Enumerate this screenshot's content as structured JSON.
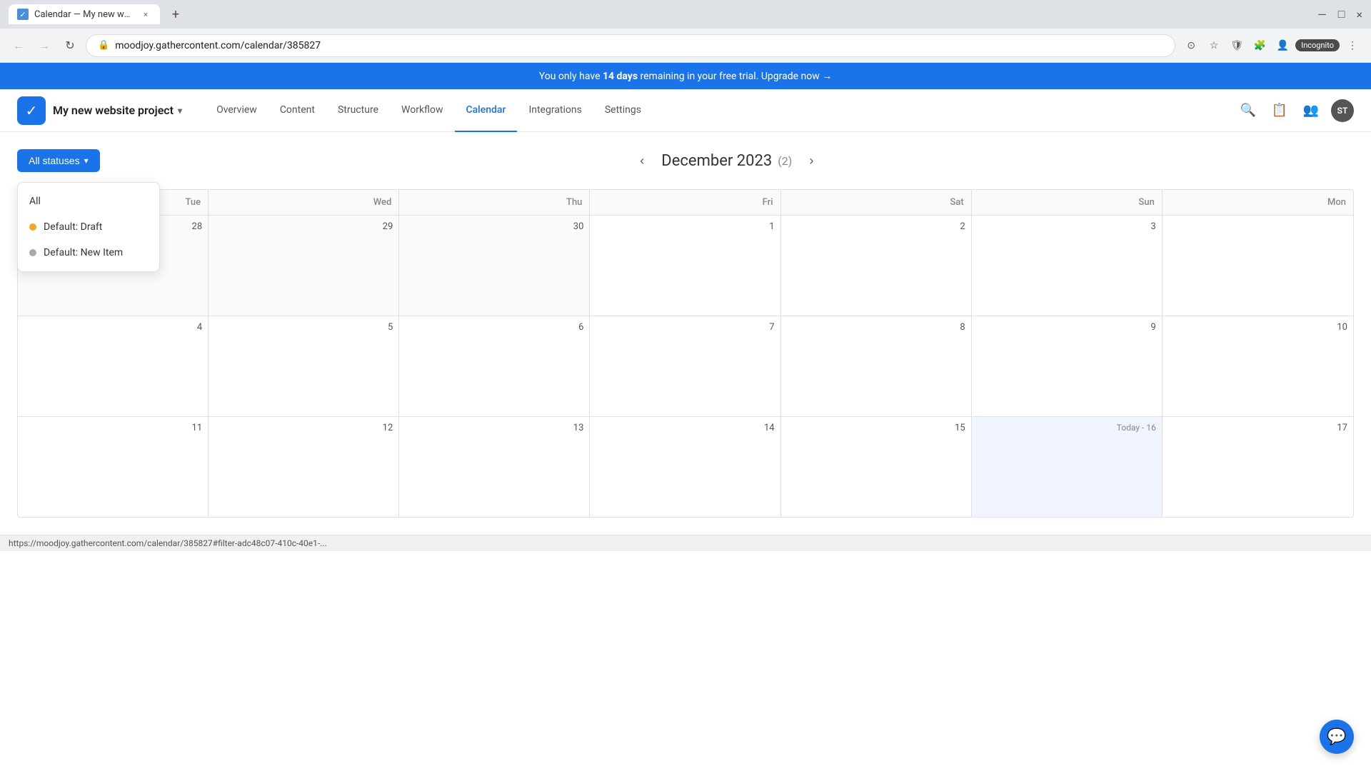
{
  "browser": {
    "tab_title": "Calendar — My new website p...",
    "tab_favicon": "✓",
    "tab_close": "×",
    "new_tab": "+",
    "nav_back": "←",
    "nav_forward": "→",
    "nav_reload": "↻",
    "address": "moodjoy.gathercontent.com/calendar/385827",
    "lock_icon": "🔒",
    "incognito_label": "Incognito",
    "minimize": "—",
    "maximize": "□",
    "close": "×"
  },
  "trial_banner": {
    "text_before": "You only have ",
    "days": "14 days",
    "text_after": " remaining in your free trial. Upgrade now →"
  },
  "header": {
    "logo_text": "✓",
    "project_name": "My new website project",
    "dropdown_arrow": "▾",
    "nav_items": [
      {
        "label": "Overview",
        "active": false
      },
      {
        "label": "Content",
        "active": false
      },
      {
        "label": "Structure",
        "active": false
      },
      {
        "label": "Workflow",
        "active": false
      },
      {
        "label": "Calendar",
        "active": true
      },
      {
        "label": "Integrations",
        "active": false
      },
      {
        "label": "Settings",
        "active": false
      }
    ],
    "search_icon": "🔍",
    "task_icon": "📋",
    "team_icon": "👥",
    "avatar_initials": "ST"
  },
  "calendar": {
    "filter_button_label": "All statuses",
    "filter_arrow": "▾",
    "prev_arrow": "‹",
    "next_arrow": "›",
    "month_title": "December 2023",
    "item_count": "(2)",
    "day_headers": [
      "Tue",
      "Wed",
      "Thu",
      "Fri",
      "Sat",
      "Sun",
      "Mon"
    ],
    "dropdown": {
      "items": [
        {
          "label": "All",
          "dot_color": null
        },
        {
          "label": "Default: Draft",
          "dot_color": "yellow"
        },
        {
          "label": "Default: New Item",
          "dot_color": "gray"
        }
      ]
    },
    "weeks": [
      {
        "days": [
          {
            "number": "28",
            "outside": true,
            "today": false,
            "today_label": false
          },
          {
            "number": "29",
            "outside": true,
            "today": false,
            "today_label": false
          },
          {
            "number": "30",
            "outside": true,
            "today": false,
            "today_label": false
          },
          {
            "number": "1",
            "outside": false,
            "today": false,
            "today_label": false
          },
          {
            "number": "2",
            "outside": false,
            "today": false,
            "today_label": false
          },
          {
            "number": "3",
            "outside": false,
            "today": false,
            "today_label": false
          },
          {
            "number": "",
            "outside": false,
            "today": false,
            "today_label": false
          }
        ]
      },
      {
        "days": [
          {
            "number": "4",
            "outside": false,
            "today": false,
            "today_label": false
          },
          {
            "number": "5",
            "outside": false,
            "today": false,
            "today_label": false
          },
          {
            "number": "6",
            "outside": false,
            "today": false,
            "today_label": false
          },
          {
            "number": "7",
            "outside": false,
            "today": false,
            "today_label": false
          },
          {
            "number": "8",
            "outside": false,
            "today": false,
            "today_label": false
          },
          {
            "number": "9",
            "outside": false,
            "today": false,
            "today_label": false
          },
          {
            "number": "10",
            "outside": false,
            "today": false,
            "today_label": false
          }
        ]
      },
      {
        "days": [
          {
            "number": "11",
            "outside": false,
            "today": false,
            "today_label": false
          },
          {
            "number": "12",
            "outside": false,
            "today": false,
            "today_label": false
          },
          {
            "number": "13",
            "outside": false,
            "today": false,
            "today_label": false
          },
          {
            "number": "14",
            "outside": false,
            "today": false,
            "today_label": false
          },
          {
            "number": "15",
            "outside": false,
            "today": false,
            "today_label": false
          },
          {
            "number": "Today - 16",
            "outside": false,
            "today": true,
            "today_label": true
          },
          {
            "number": "17",
            "outside": false,
            "today": false,
            "today_label": false
          }
        ]
      }
    ]
  },
  "status_bar": {
    "url": "https://moodjoy.gathercontent.com/calendar/385827#filter-adc48c07-410c-40e1-..."
  }
}
